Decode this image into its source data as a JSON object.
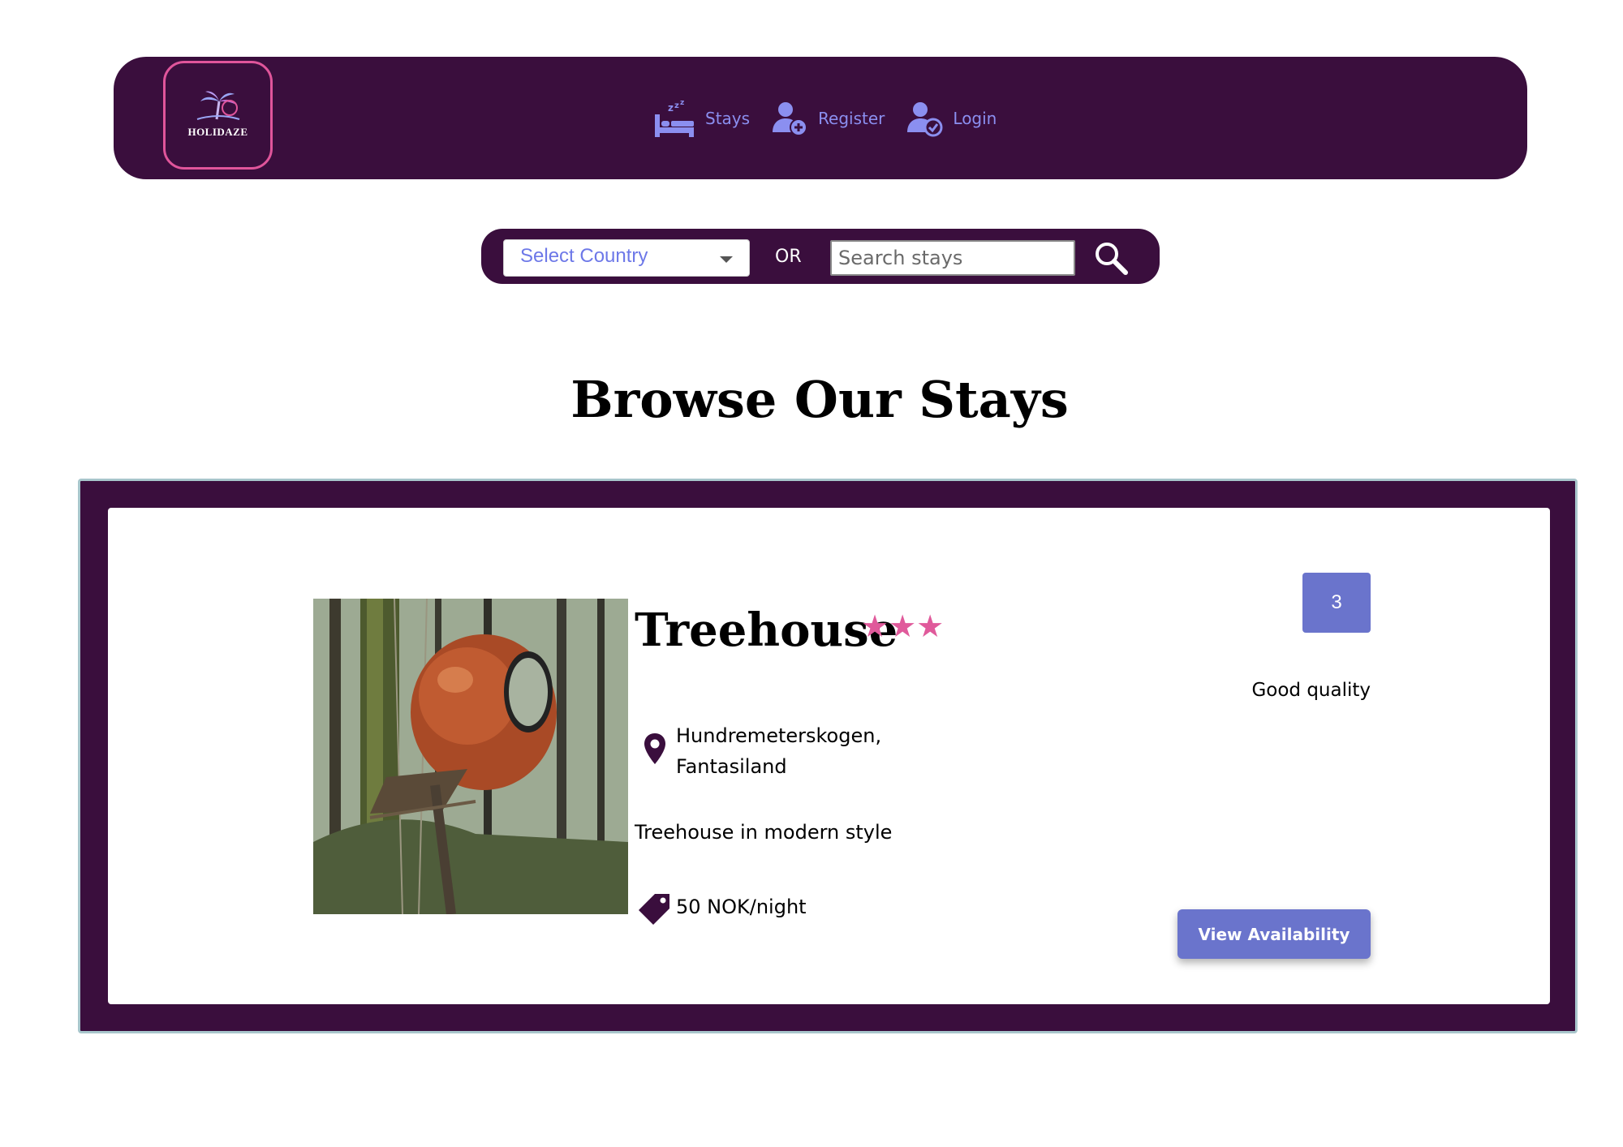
{
  "nav": {
    "logo_text": "HOLIDAZE",
    "items": [
      {
        "label": "Stays",
        "icon": "bed-sleep-icon"
      },
      {
        "label": "Register",
        "icon": "user-plus-icon"
      },
      {
        "label": "Login",
        "icon": "user-check-icon"
      }
    ]
  },
  "search": {
    "country_select": "Select Country",
    "or_label": "OR",
    "placeholder": "Search stays",
    "button_icon": "search-icon"
  },
  "page": {
    "title": "Browse Our Stays"
  },
  "stay": {
    "name": "Treehouse",
    "stars": "★★★",
    "star_count": 3,
    "location_line1": "Hundremeterskogen,",
    "location_line2": "Fantasiland",
    "description": "Treehouse in modern style",
    "price": "50 NOK/night",
    "rating": "3",
    "rating_label": "Good quality",
    "button_label": "View Availability"
  },
  "colors": {
    "brand_purple": "#3a0e3d",
    "accent_pink": "#e0559b",
    "nav_link": "#8b8ff0",
    "button_blue": "#6a74cc"
  }
}
